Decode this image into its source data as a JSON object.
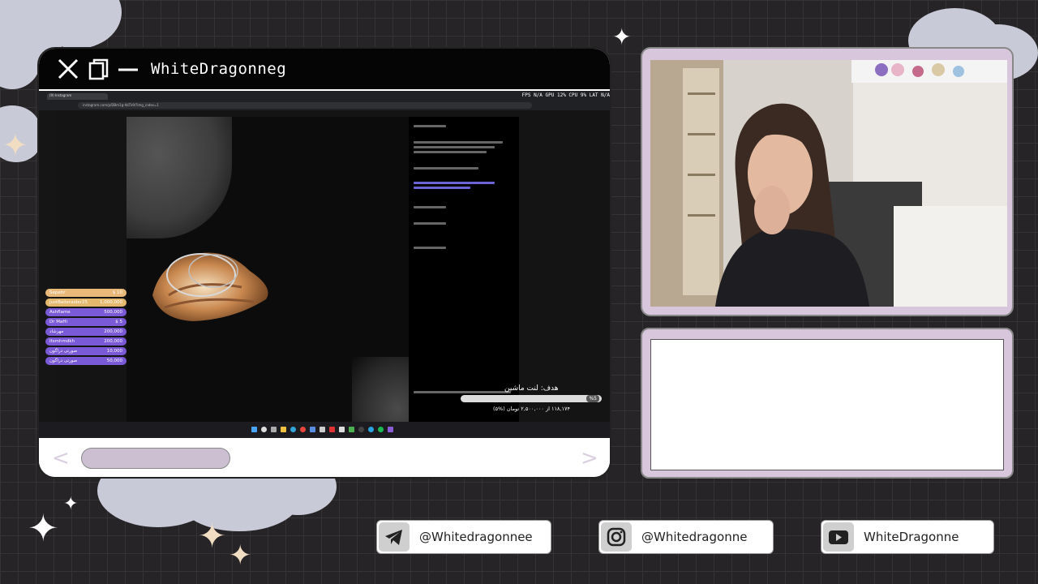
{
  "window": {
    "title": "WhiteDragonneg",
    "close_icon": "close-x-icon",
    "copy_icon": "copy-icon",
    "minimize_icon": "minimize-icon"
  },
  "stream": {
    "browser": {
      "tab_label": "(9) Instagram",
      "address": "instagram.com/p/DBm1g-hbTk9/?img_index=1",
      "perf_text": "FPS N/A   GPU 12%   CPU 9%   LAT N/A"
    },
    "donations": [
      {
        "name": "Sepehr",
        "amount": "$ 10",
        "color": "#e9b97a"
      },
      {
        "name": "JustBaileraider25",
        "amount": "1,000,000",
        "color": "#e4b86d"
      },
      {
        "name": "Ashflame",
        "amount": "500,000",
        "color": "#7a5ad6"
      },
      {
        "name": "Dr MaHi",
        "amount": "$ 5",
        "color": "#7a5ad6"
      },
      {
        "name": "مهرشاد",
        "amount": "200,000",
        "color": "#7a5ad6"
      },
      {
        "name": "Itsmhmdkh",
        "amount": "200,000",
        "color": "#7a5ad6"
      },
      {
        "name": "صورتی دراگون",
        "amount": "10,000",
        "color": "#7a5ad6"
      },
      {
        "name": "صورتی دراگون",
        "amount": "50,000",
        "color": "#7a5ad6"
      }
    ],
    "goal": {
      "title": "هدف: لنت ماشین",
      "percent_label": "%5",
      "percent": 5,
      "amount_text": "۱۱۸,۱۷۴ از ۲,۵۰۰,۰۰۰ تومان (%۵)"
    }
  },
  "nav": {
    "prev_arrow": "<",
    "next_arrow": ">"
  },
  "socials": [
    {
      "icon": "telegram-icon",
      "handle": "@Whitedragonnee"
    },
    {
      "icon": "instagram-icon",
      "handle": "@Whitedragonne"
    },
    {
      "icon": "youtube-icon",
      "handle": "WhiteDragonne"
    }
  ],
  "colors": {
    "background": "#262426",
    "frame_lavender": "#d7c6dc",
    "scroll_thumb": "#cbbfd1",
    "cloud": "#c9cad7",
    "sparkle": "#f1dec2"
  }
}
